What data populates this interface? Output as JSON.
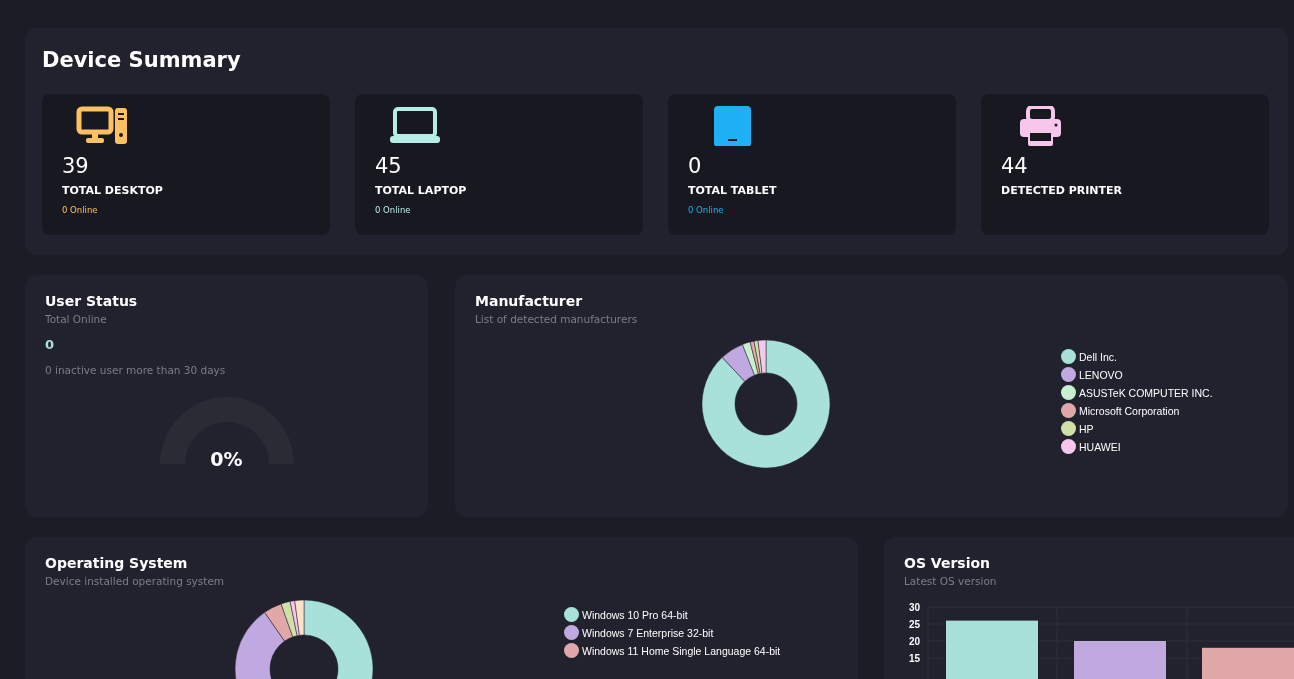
{
  "device_summary": {
    "title": "Device Summary",
    "cards": [
      {
        "kind": "desktop",
        "color": "#ffc061",
        "count": "39",
        "label": "TOTAL DESKTOP",
        "online": "0 Online"
      },
      {
        "kind": "laptop",
        "color": "#b4ece6",
        "count": "45",
        "label": "TOTAL LAPTOP",
        "online": "0 Online"
      },
      {
        "kind": "tablet",
        "color": "#1fb0f5",
        "count": "0",
        "label": "TOTAL TABLET",
        "online": "0 Online"
      },
      {
        "kind": "printer",
        "color": "#f7c6ec",
        "count": "44",
        "label": "DETECTED PRINTER"
      }
    ]
  },
  "user_status": {
    "title": "User Status",
    "subtitle": "Total Online",
    "value": "0",
    "note": "0 inactive user more than 30 days",
    "gauge": {
      "reading": "0%"
    }
  },
  "manufacturer": {
    "title": "Manufacturer",
    "subtitle": "List of detected manufacturers",
    "legend": [
      {
        "name": "Dell Inc.",
        "color": "#a8e0da"
      },
      {
        "name": "LENOVO",
        "color": "#c0a8e0"
      },
      {
        "name": "ASUSTeK COMPUTER INC.",
        "color": "#c8f0d0"
      },
      {
        "name": "Microsoft Corporation",
        "color": "#e0a8a8"
      },
      {
        "name": "HP",
        "color": "#d0e0a8"
      },
      {
        "name": "HUAWEI",
        "color": "#f7c6ec"
      }
    ]
  },
  "operating_system": {
    "title": "Operating System",
    "subtitle": "Device installed operating system",
    "legend": [
      {
        "name": "Windows 10 Pro 64-bit",
        "color": "#a8e0da"
      },
      {
        "name": "Windows 7 Enterprise 32-bit",
        "color": "#c0a8e0"
      },
      {
        "name": "Windows 11 Home Single Language 64-bit",
        "color": "#e0a8a8"
      }
    ]
  },
  "os_version": {
    "title": "OS Version",
    "subtitle": "Latest OS version",
    "chart_data": {
      "type": "bar",
      "ylim": [
        0,
        30
      ],
      "yticks": [
        15,
        20,
        25,
        30
      ],
      "grid": true,
      "series": [
        {
          "color": "#a8e0da",
          "values": [
            26,
            null,
            null
          ]
        },
        {
          "color": "#c0a8e0",
          "values": [
            null,
            20,
            null
          ]
        },
        {
          "color": "#e0a8a8",
          "values": [
            null,
            null,
            18
          ]
        }
      ]
    }
  }
}
